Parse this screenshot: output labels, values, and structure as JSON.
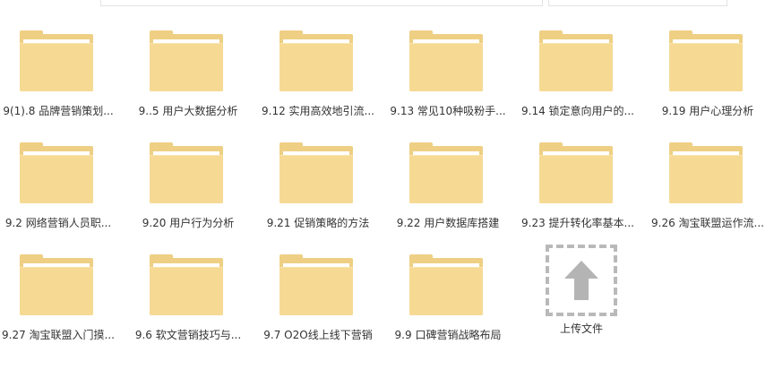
{
  "folders": [
    {
      "name": "9(1).8 品牌营销策划..."
    },
    {
      "name": "9..5 用户大数据分析"
    },
    {
      "name": "9.12 实用高效地引流..."
    },
    {
      "name": "9.13 常见10种吸粉手..."
    },
    {
      "name": "9.14 锁定意向用户的..."
    },
    {
      "name": "9.19 用户心理分析"
    },
    {
      "name": "9.2 网络营销人员职..."
    },
    {
      "name": "9.20 用户行为分析"
    },
    {
      "name": "9.21 促销策略的方法"
    },
    {
      "name": "9.22 用户数据库搭建"
    },
    {
      "name": "9.23 提升转化率基本..."
    },
    {
      "name": "9.26 淘宝联盟运作流..."
    },
    {
      "name": "9.27 淘宝联盟入门摸..."
    },
    {
      "name": "9.6 软文营销技巧与..."
    },
    {
      "name": "9.7 O2O线上线下营销"
    },
    {
      "name": "9.9 口碑营销战略布局"
    }
  ],
  "upload": {
    "label": "上传文件",
    "icon": "upload-arrow-icon"
  },
  "colors": {
    "folder_back": "#eecf84",
    "folder_front": "#f6da94",
    "dashed_border": "#b9b9b9",
    "arrow": "#b4b4b4",
    "text": "#333333"
  }
}
